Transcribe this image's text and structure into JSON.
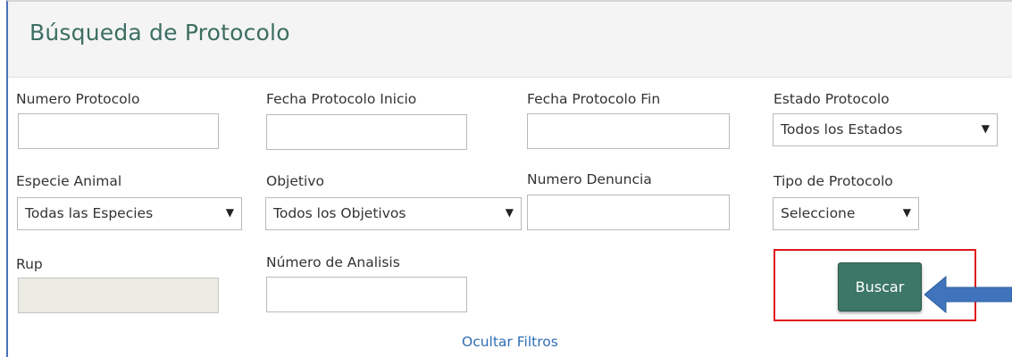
{
  "panel": {
    "title": "Búsqueda de Protocolo"
  },
  "filters": {
    "numero_protocolo": {
      "label": "Numero Protocolo",
      "value": ""
    },
    "fecha_inicio": {
      "label": "Fecha Protocolo Inicio",
      "value": ""
    },
    "fecha_fin": {
      "label": "Fecha Protocolo Fin",
      "value": ""
    },
    "estado": {
      "label": "Estado Protocolo",
      "selected": "Todos los Estados"
    },
    "especie": {
      "label": "Especie Animal",
      "selected": "Todas las Especies"
    },
    "objetivo": {
      "label": "Objetivo",
      "selected": "Todos los Objetivos"
    },
    "numero_denuncia": {
      "label": "Numero Denuncia",
      "value": ""
    },
    "tipo": {
      "label": "Tipo de Protocolo",
      "selected": "Seleccione"
    },
    "rup": {
      "label": "Rup",
      "value": ""
    },
    "numero_analisis": {
      "label": "Número de Analisis",
      "value": ""
    }
  },
  "actions": {
    "search_label": "Buscar",
    "toggle_filters_label": "Ocultar Filtros"
  },
  "icons": {
    "dropdown": "caret-down-icon",
    "annotation_arrow": "arrow-left-icon"
  },
  "colors": {
    "title": "#3c6e61",
    "button": "#3d7766",
    "link": "#2f6db5",
    "highlight": "#e0161c",
    "arrow": "#3f74bd"
  }
}
